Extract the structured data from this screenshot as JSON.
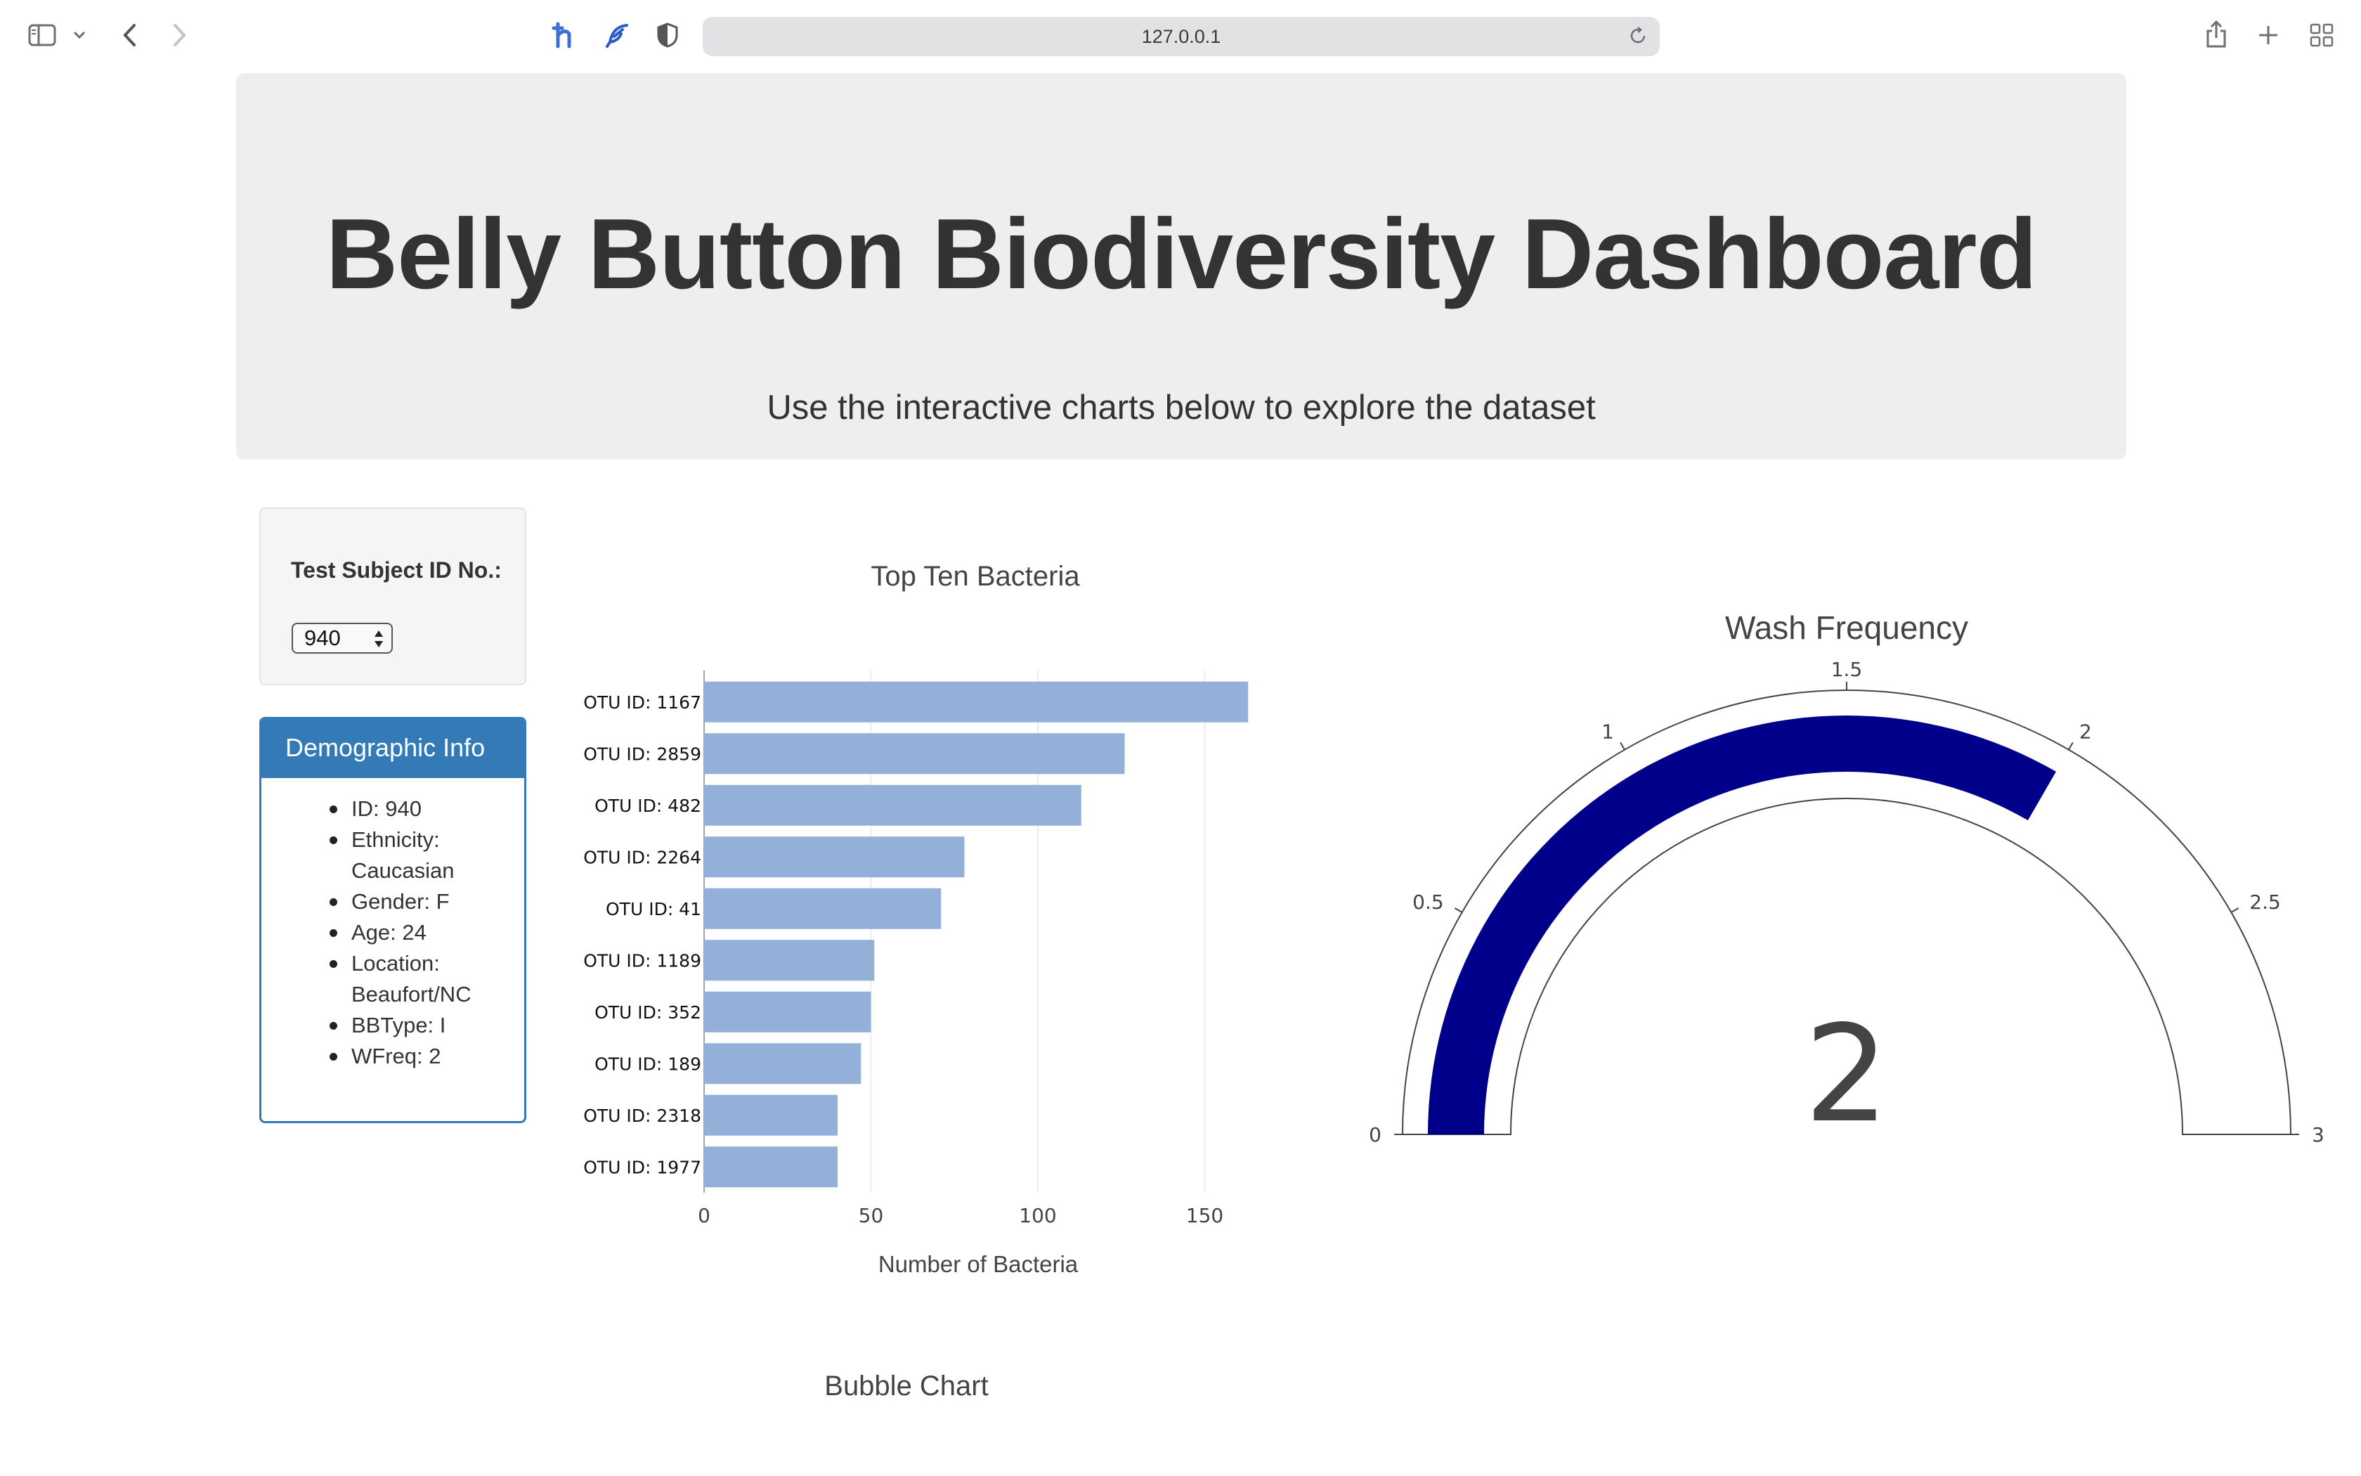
{
  "browser": {
    "url": "127.0.0.1",
    "icons": [
      "sidebar-icon",
      "chevron-down-icon",
      "back-icon",
      "forward-icon",
      "extension-h-icon",
      "extension-feather-icon",
      "shield-icon",
      "reload-icon",
      "share-icon",
      "new-tab-icon",
      "tab-overview-icon"
    ]
  },
  "header": {
    "title": "Belly Button Biodiversity Dashboard",
    "subtitle": "Use the interactive charts below to explore the dataset"
  },
  "selector": {
    "label": "Test Subject ID No.:",
    "value": "940"
  },
  "demographic": {
    "title": "Demographic Info",
    "items": [
      "ID: 940",
      "Ethnicity: Caucasian",
      "Gender: F",
      "Age: 24",
      "Location: Beaufort/NC",
      "BBType: I",
      "WFreq: 2"
    ]
  },
  "bar_chart": {
    "title": "Top Ten Bacteria",
    "xlabel": "Number of Bacteria"
  },
  "gauge": {
    "title": "Wash Frequency",
    "value_text": "2"
  },
  "bubble": {
    "title": "Bubble Chart"
  },
  "colors": {
    "accent": "#337ab7",
    "bar": "#93b0d8",
    "gauge_bar": "#00008b"
  },
  "chart_data": [
    {
      "type": "bar",
      "orientation": "horizontal",
      "title": "Top Ten Bacteria",
      "xlabel": "Number of Bacteria",
      "ylabel": "",
      "categories": [
        "OTU ID: 1167",
        "OTU ID: 2859",
        "OTU ID: 482",
        "OTU ID: 2264",
        "OTU ID: 41",
        "OTU ID: 1189",
        "OTU ID: 352",
        "OTU ID: 189",
        "OTU ID: 2318",
        "OTU ID: 1977"
      ],
      "values": [
        163,
        126,
        113,
        78,
        71,
        51,
        50,
        47,
        40,
        40
      ],
      "xlim": [
        0,
        168
      ],
      "xticks": [
        0,
        50,
        100,
        150
      ],
      "grid": true
    },
    {
      "type": "gauge",
      "title": "Wash Frequency",
      "value": 2,
      "range": [
        0,
        3
      ],
      "ticks": [
        0,
        0.5,
        1,
        1.5,
        2,
        2.5,
        3
      ]
    }
  ]
}
